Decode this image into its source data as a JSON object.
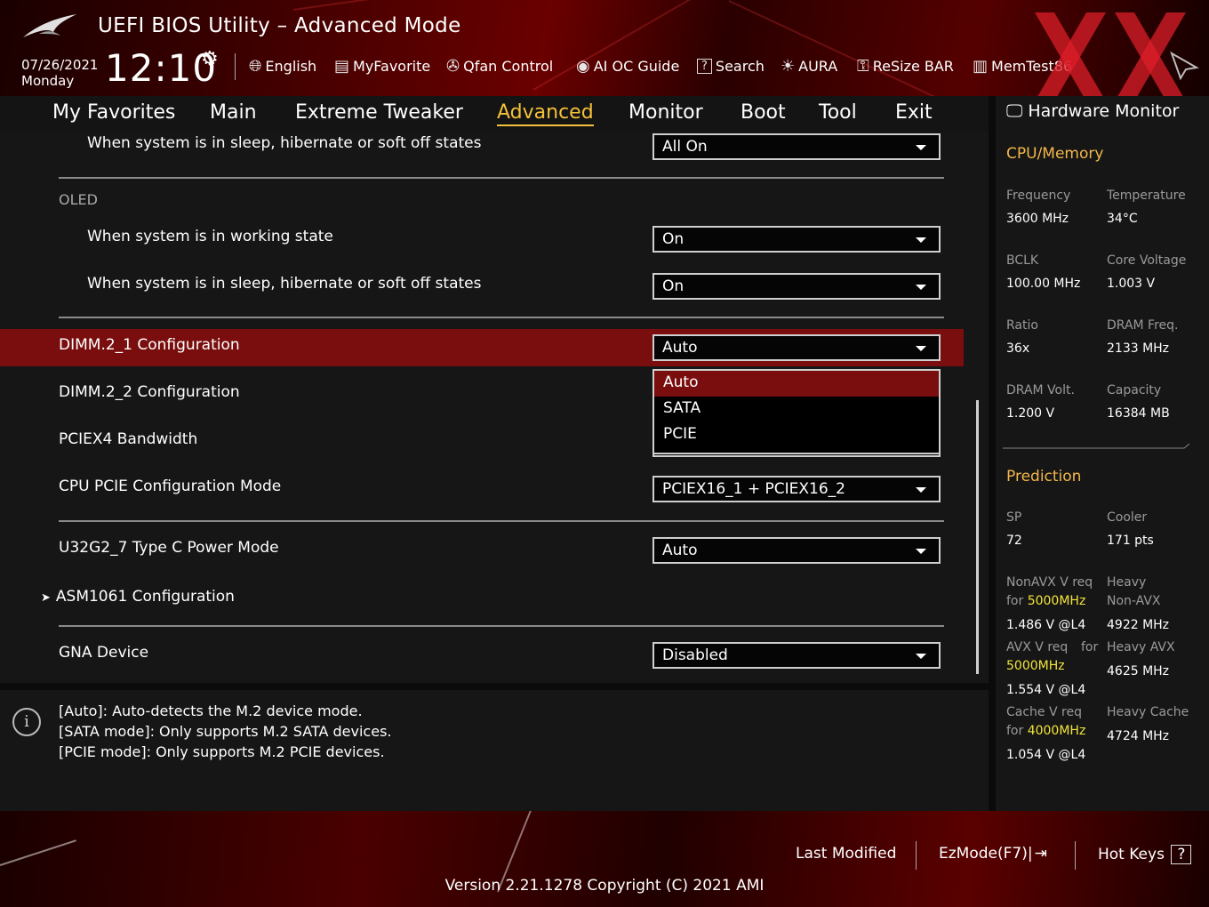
{
  "header": {
    "title": "UEFI BIOS Utility – Advanced Mode",
    "date": "07/26/2021",
    "day": "Monday",
    "time": "12:10",
    "tools": [
      {
        "icon": "globe-icon",
        "label": "English"
      },
      {
        "icon": "favorite-icon",
        "label": "MyFavorite"
      },
      {
        "icon": "fan-icon",
        "label": "Qfan Control"
      },
      {
        "icon": "ai-oc-icon",
        "label": "AI OC Guide"
      },
      {
        "icon": "search-icon",
        "label": "Search"
      },
      {
        "icon": "aura-icon",
        "label": "AURA"
      },
      {
        "icon": "resize-bar-icon",
        "label": "ReSize BAR"
      },
      {
        "icon": "memtest-icon",
        "label": "MemTest86"
      }
    ]
  },
  "nav": {
    "tabs": [
      "My Favorites",
      "Main",
      "Extreme Tweaker",
      "Advanced",
      "Monitor",
      "Boot",
      "Tool",
      "Exit"
    ],
    "active": "Advanced"
  },
  "settings": {
    "sleep_state_1": {
      "label": "When system is in sleep, hibernate or soft off states",
      "value": "All On"
    },
    "oled_section": "OLED",
    "oled_working": {
      "label": "When system is in working state",
      "value": "On"
    },
    "oled_sleep": {
      "label": "When system is in sleep, hibernate or soft off states",
      "value": "On"
    },
    "dimm2_1": {
      "label": "DIMM.2_1 Configuration",
      "value": "Auto"
    },
    "dimm2_2": {
      "label": "DIMM.2_2 Configuration"
    },
    "pciex4": {
      "label": "PCIEX4 Bandwidth"
    },
    "cpu_pcie": {
      "label": "CPU PCIE Configuration Mode",
      "value": "PCIEX16_1 + PCIEX16_2"
    },
    "u32g2": {
      "label": "U32G2_7 Type C Power Mode",
      "value": "Auto"
    },
    "asm1061": {
      "label": "ASM1061 Configuration"
    },
    "gna": {
      "label": "GNA Device",
      "value": "Disabled"
    }
  },
  "dropdown_options": [
    "Auto",
    "SATA",
    "PCIE"
  ],
  "help": {
    "lines": [
      "[Auto]: Auto-detects the M.2 device mode.",
      "[SATA mode]: Only supports M.2 SATA devices.",
      "[PCIE mode]: Only supports M.2 PCIE devices."
    ]
  },
  "hw_monitor": {
    "title": "Hardware Monitor",
    "cpu_memory_title": "CPU/Memory",
    "frequency_label": "Frequency",
    "frequency": "3600 MHz",
    "temperature_label": "Temperature",
    "temperature": "34°C",
    "bclk_label": "BCLK",
    "bclk": "100.00 MHz",
    "core_voltage_label": "Core Voltage",
    "core_voltage": "1.003 V",
    "ratio_label": "Ratio",
    "ratio": "36x",
    "dram_freq_label": "DRAM Freq.",
    "dram_freq": "2133 MHz",
    "dram_volt_label": "DRAM Volt.",
    "dram_volt": "1.200 V",
    "capacity_label": "Capacity",
    "capacity": "16384 MB",
    "prediction_title": "Prediction",
    "sp_label": "SP",
    "sp": "72",
    "cooler_label": "Cooler",
    "cooler": "171 pts",
    "nonavx_label_1": "NonAVX V req",
    "nonavx_for": "for",
    "nonavx_freq": "5000MHz",
    "nonavx_value": "1.486 V @L4",
    "heavy_label_1": "Heavy",
    "heavy_label_2": "Non-AVX",
    "heavy_nonavx_value": "4922 MHz",
    "avx_label": "AVX V req",
    "avx_for": "for",
    "avx_freq": "5000MHz",
    "avx_value": "1.554 V @L4",
    "heavy_avx_label": "Heavy AVX",
    "heavy_avx_value": "4625 MHz",
    "cache_label": "Cache V req",
    "cache_for": "for",
    "cache_freq": "4000MHz",
    "cache_value": "1.054 V @L4",
    "heavy_cache_label": "Heavy Cache",
    "heavy_cache_value": "4724 MHz"
  },
  "footer": {
    "last_modified": "Last Modified",
    "ezmode": "EzMode(F7)|",
    "hotkeys": "Hot Keys",
    "hotkeys_icon": "?",
    "version": "Version 2.21.1278 Copyright (C) 2021 AMI"
  },
  "colors": {
    "accent": "#f3c13a",
    "highlight_row": "#7a0e0e",
    "monitor_section": "#f3b74a",
    "monitor_freq": "#f3e53a"
  }
}
